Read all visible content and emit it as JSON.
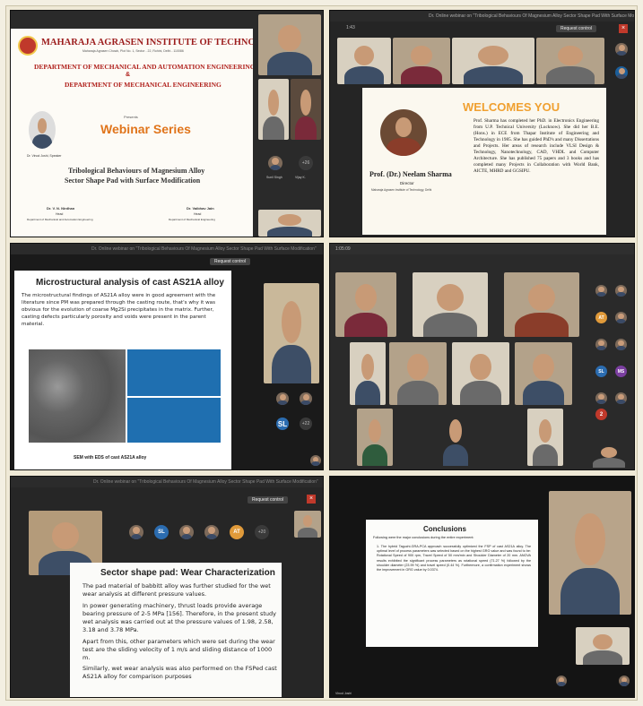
{
  "p1": {
    "institute": "MAHARAJA AGRASEN INSTITUTE OF TECHNOLOGY",
    "address": "Maharaja Agrasen Chowk, Plot No. 1, Sector - 22, Rohini, Delhi - 110086",
    "dept1": "DEPARTMENT OF MECHANICAL AND AUTOMATION ENGINEERING",
    "amp": "&",
    "dept2": "DEPARTMENT OF MECHANICAL ENGINEERING",
    "presents": "Presents",
    "series": "Webinar Series",
    "talk_line1": "Tribological Behaviours of Magnesium Alloy",
    "talk_line2": "Sector Shape Pad with Surface Modification",
    "speaker": "Dr. Vinod Joshi, Speaker",
    "hod1_name": "Dr. V. N. Nirdhan",
    "hod1_role": "Head",
    "hod1_dept": "Department of Mechanical and Automation Engineering",
    "hod2_name": "Dr. Vaibhav Jain",
    "hod2_role": "Head",
    "hod2_dept": "Department of Mechanical Engineering",
    "tile_names": [
      "Sunil Singh",
      "Vijay K."
    ],
    "more_label": "+26"
  },
  "p2": {
    "title_bar": "Dr. Online webinar on \"Tribological Behaviours Of Magnesium Alloy Sector Shape Pad With Surface Modification\"",
    "time": "1:43",
    "request_control": "Request control",
    "welcome": "WELCOMES YOU",
    "name": "Prof. (Dr.) Neelam Sharma",
    "role": "Director",
    "org": "Maharaja Agrasen Institute of Technology, Delhi",
    "bio": "Prof. Sharma has completed her PhD. in Electronics Engineering from U.P. Technical University (Lucknow). She did her B.E. (Hons.) in ECE from Thapar Institute of Engineering and Technology in 1985. She has guided PhD's and many Dissertations and Projects. Her areas of research include VLSI Design & Technology, Nanotechnology, CAD, VHDL and Computer Architecture. She has published 75 papers and 3 books and has completed many Projects in Collaboration with World Bank, AICTE, MHRD and GGSIPU."
  },
  "p3": {
    "title_bar": "Dr. Online webinar on \"Tribological Behaviours Of Magnesium Alloy Sector Shape Pad With Surface Modification\"",
    "request_control": "Request control",
    "slide_title": "Microstructural analysis of cast AS21A alloy",
    "slide_text": "The microstructural findings of AS21A alloy were in good agreement with the literature since PM was prepared through the casting route, that's why it was obvious for the evolution of coarse Mg2Si precipitates in the matrix. Further, casting defects particularly porosity and voids were present in the parent material.",
    "caption": "SEM with EDS of cast AS21A alloy",
    "initials": "SL",
    "more_label": "+22"
  },
  "p4": {
    "time": "1:05:09",
    "side_initials": [
      "AT",
      "SL",
      "MS",
      "2"
    ]
  },
  "p5": {
    "title_bar": "Dr. Online webinar on \"Tribological Behaviours Of Magnesium Alloy Sector Shape Pad With Surface Modification\"",
    "request_control": "Request control",
    "strip_initials": [
      "SL",
      "AT"
    ],
    "more_label": "+20",
    "slide_title": "Sector shape pad: Wear Characterization",
    "bullets": [
      "The pad material of babbitt alloy was further studied for the wet wear analysis at different pressure values.",
      "In power generating machinery, thrust loads provide average bearing pressure of 2-5 MPa [156]. Therefore, in the present study wet analysis was carried out at the pressure values of 1.98, 2.58, 3.18 and 3.78 MPa.",
      "Apart from this, other parameters which were set during the wear test are the sliding velocity of 1 m/s and sliding distance of 1000 m.",
      "Similarly, wet wear analysis was also performed on the FSPed cast AS21A alloy for comparison purposes"
    ]
  },
  "p6": {
    "slide_title": "Conclusions",
    "intro": "Following were the major conclusions during the entire experiment:",
    "point": "1. The hybrid Taguchi-GRA-PCA approach successfully optimized the FSP of cast AS21A alloy. The optimal level of process parameters was selected based on the highest GRG value and was found to be: Rotational Speed of 900 rpm, Travel Speed of 50 mm/min and Shoulder Diameter of 20 mm. ANOVA results exhibited the significant process parameters as rotational speed (71.27 %) followed by the shoulder diameter (23.99 %) and travel speed (0.44 %). Furthermore, a confirmation experiment shows the improvement in GRG value by 0.0374.",
    "footer_name": "Vinod Joshi"
  },
  "colors": {
    "institute_red": "#9c1c1c",
    "dept_red": "#b0201c",
    "webinar_orange": "#e0741a",
    "welcome_orange": "#f0a030",
    "dark_panel": "#1d1d1d"
  }
}
